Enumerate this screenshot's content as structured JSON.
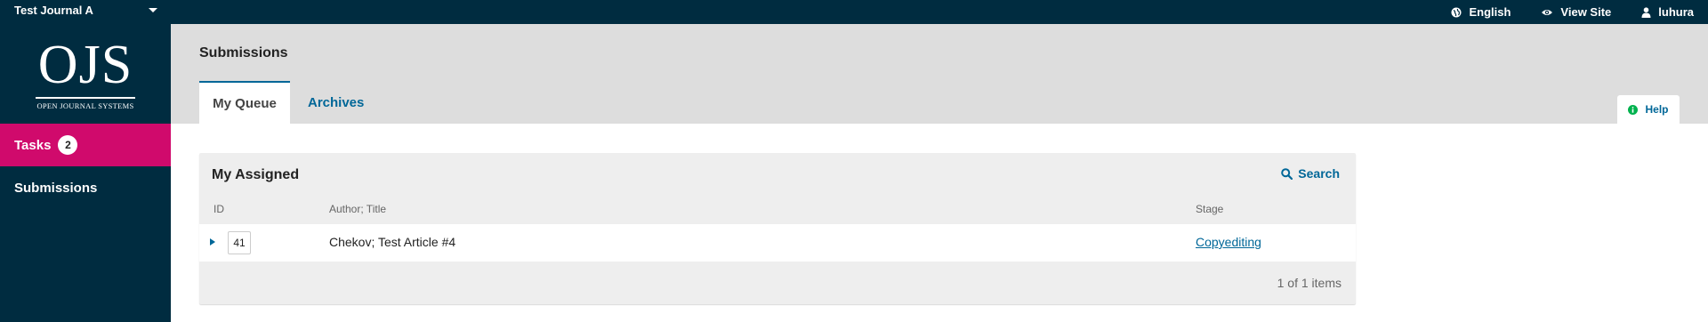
{
  "colors": {
    "nav_bg": "#002c40",
    "accent_pink": "#d00a6c",
    "link_blue": "#006798",
    "header_bg": "#dddddd",
    "panel_bg": "#eeeeee",
    "help_green": "#00b24e"
  },
  "topbar": {
    "journal": "Test Journal A",
    "language": {
      "label": "English",
      "icon": "globe-icon"
    },
    "view_site": {
      "label": "View Site",
      "icon": "eye-icon"
    },
    "user": {
      "label": "luhura",
      "icon": "user-icon"
    }
  },
  "sidebar": {
    "logo": {
      "main": "OJS",
      "sub": "OPEN JOURNAL SYSTEMS"
    },
    "items": [
      {
        "label": "Tasks",
        "badge": "2",
        "active": true
      },
      {
        "label": "Submissions",
        "active": false
      }
    ]
  },
  "header": {
    "title": "Submissions",
    "tabs": [
      {
        "label": "My Queue",
        "active": true
      },
      {
        "label": "Archives",
        "active": false
      }
    ],
    "help": {
      "label": "Help",
      "icon": "info-icon"
    }
  },
  "panel": {
    "title": "My Assigned",
    "search": {
      "label": "Search",
      "icon": "search-icon"
    },
    "columns": [
      "ID",
      "Author; Title",
      "Stage"
    ],
    "rows": [
      {
        "id": "41",
        "title": "Chekov; Test Article #4",
        "stage": "Copyediting"
      }
    ],
    "pagination": "1 of 1 items"
  }
}
